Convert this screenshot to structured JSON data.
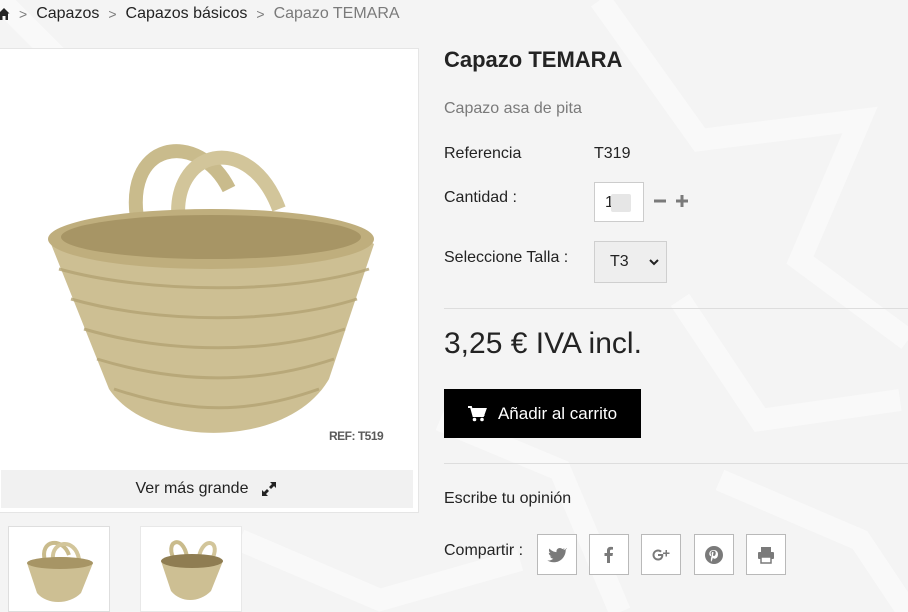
{
  "breadcrumb": {
    "home_icon": "home-icon",
    "items": [
      "Capazos",
      "Capazos básicos"
    ],
    "current": "Capazo TEMARA"
  },
  "gallery": {
    "main_image_ref_text": "REF: T519",
    "zoom_label": "Ver más grande",
    "zoom_icon": "expand-icon",
    "thumbnails": [
      "basket-front-thumbnail",
      "basket-side-thumbnail"
    ]
  },
  "product": {
    "title": "Capazo TEMARA",
    "subtitle": "Capazo asa de pita",
    "reference_label": "Referencia",
    "reference_value": "T319",
    "quantity_label": "Cantidad :",
    "quantity_value": "1",
    "size_label": "Seleccione Talla :",
    "size_selected": "T3",
    "price": "3,25 € IVA incl.",
    "add_to_cart_label": "Añadir al carrito",
    "review_link": "Escribe tu opinión",
    "share_label": "Compartir :",
    "share_icons": [
      "twitter-icon",
      "facebook-icon",
      "google-plus-icon",
      "pinterest-icon",
      "print-icon"
    ]
  },
  "colors": {
    "button_bg": "#000000",
    "text_primary": "#232323",
    "text_muted": "#7a7a7a",
    "basket": "#cdbf93"
  }
}
